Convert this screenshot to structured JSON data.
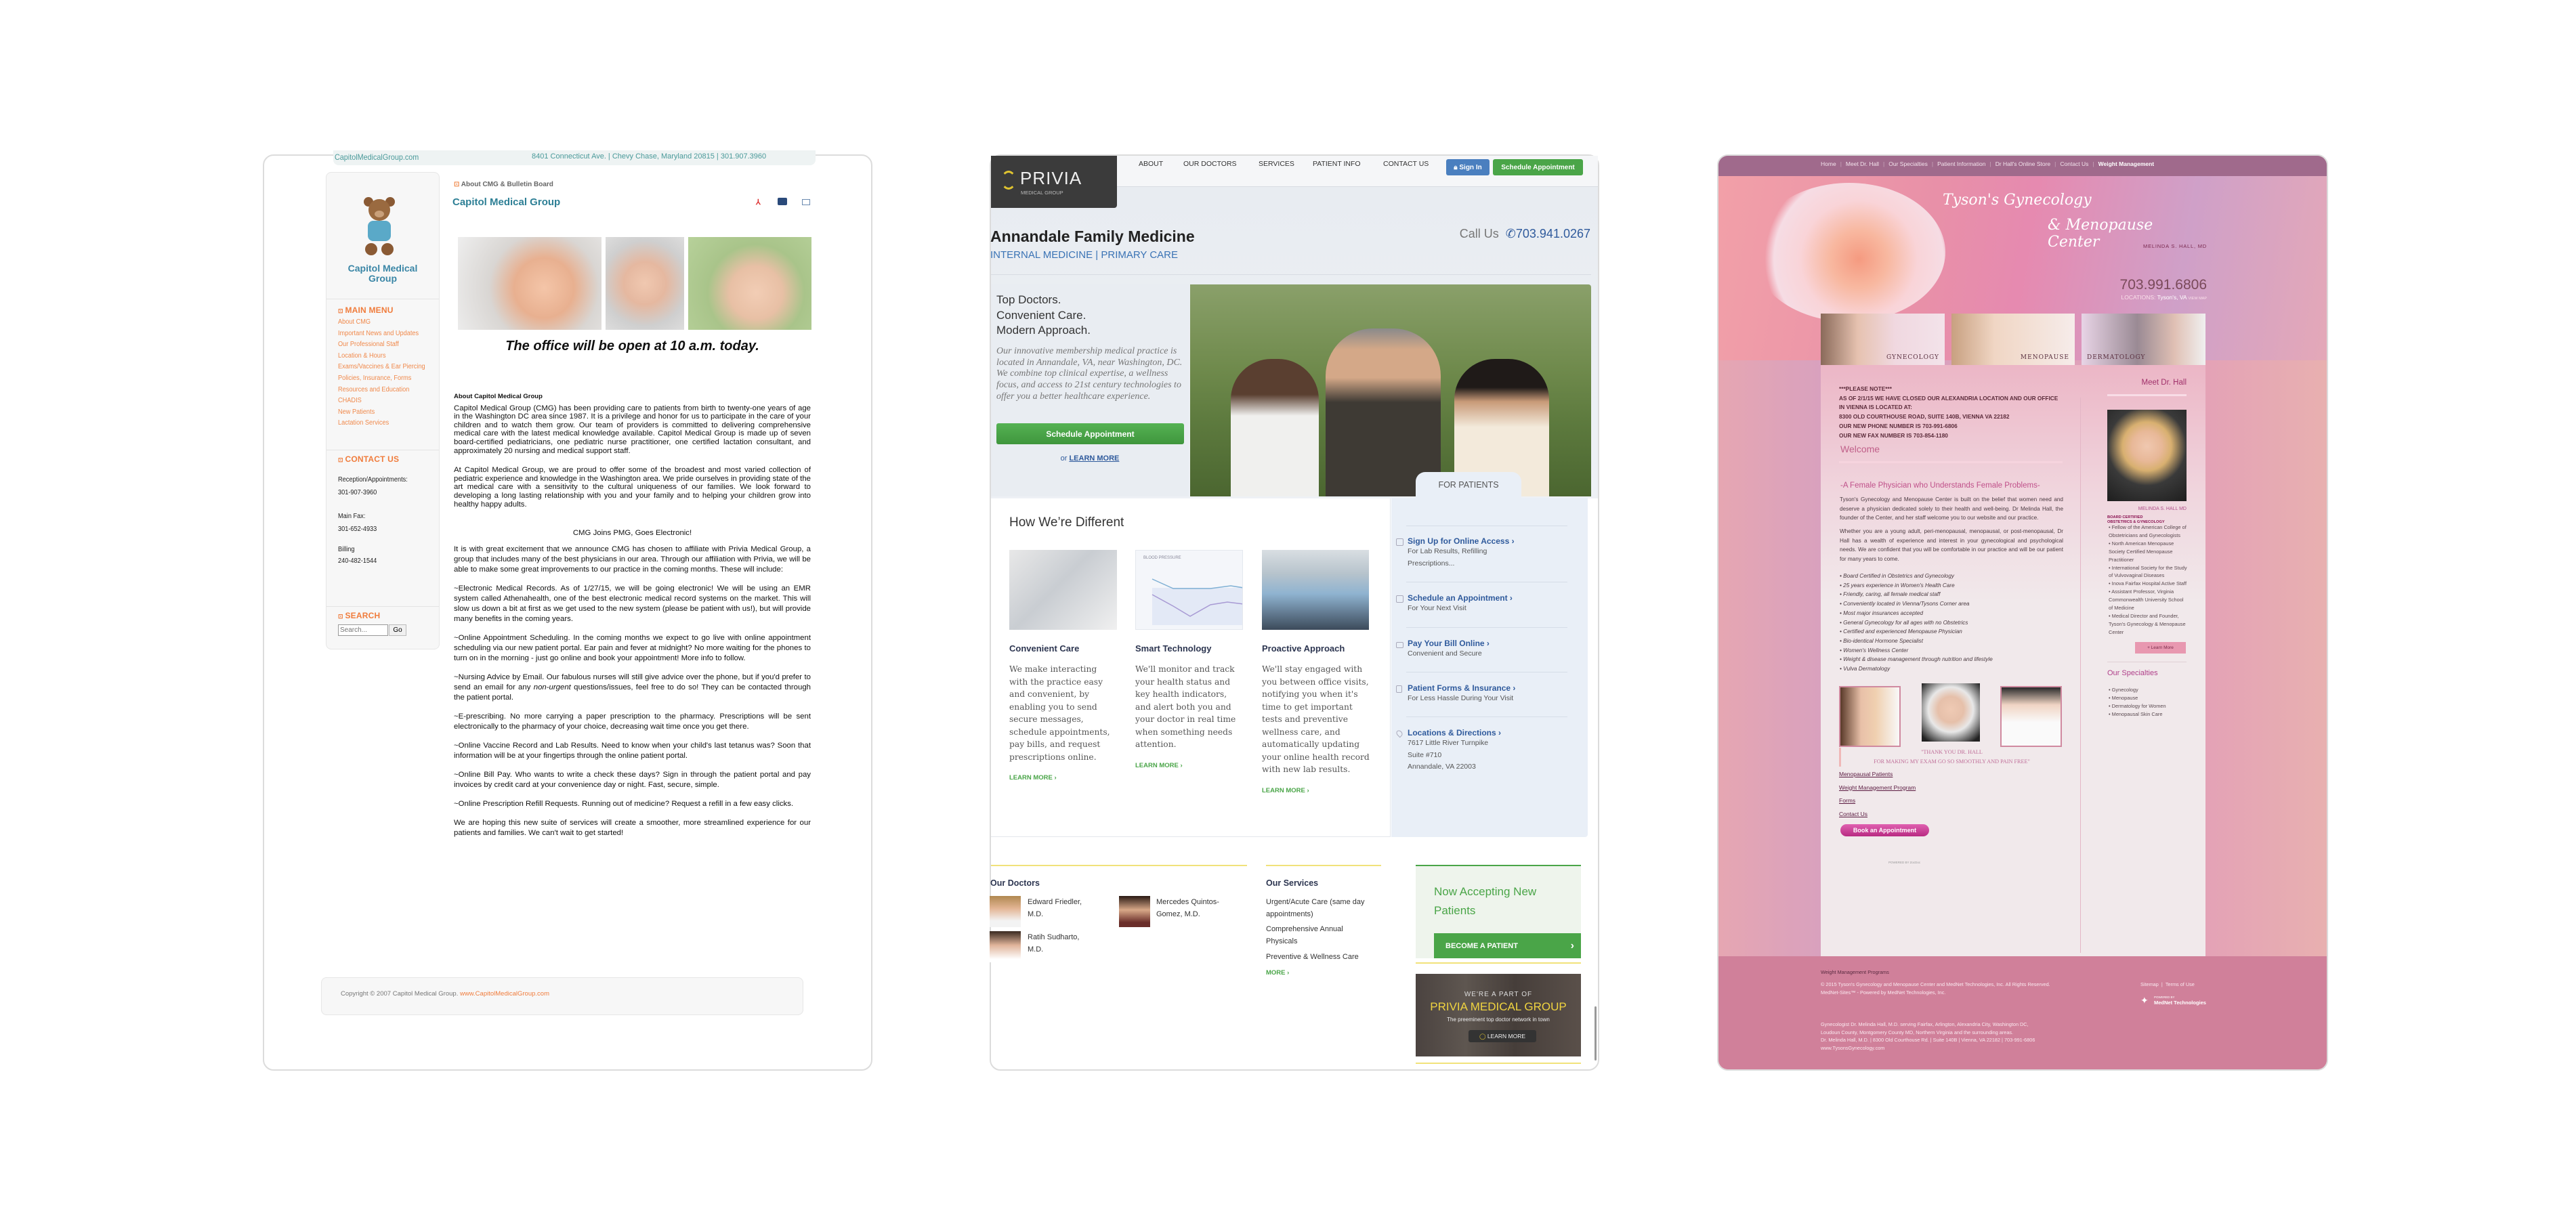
{
  "capitol": {
    "topbar": {
      "site": "CapitolMedicalGroup.com",
      "address": "8401 Connecticut Ave. | Chevy Chase, Maryland 20815  | 301.907.3960"
    },
    "logo_text": "Capitol Medical Group",
    "breadcrumb": "About CMG & Bulletin Board",
    "title": "Capitol Medical Group",
    "toolbar_icons": [
      "pdf-icon",
      "print-icon",
      "email-icon"
    ],
    "main_menu": {
      "heading": "MAIN MENU",
      "items": [
        "About CMG",
        "Important News and Updates",
        "Our Professional Staff",
        "Location & Hours",
        "Exams/Vaccines & Ear Piercing",
        "Policies, Insurance, Forms",
        "Resources and Education",
        "CHADIS",
        "New Patients",
        "Lactation Services"
      ]
    },
    "contact": {
      "heading": "CONTACT US",
      "reception_label": "Reception/Appointments:",
      "reception": "301-907-3960",
      "fax_label": "Main Fax:",
      "fax": "301-652-4933",
      "billing_label": "Billing",
      "billing": "240-482-1544"
    },
    "search": {
      "heading": "SEARCH",
      "placeholder": "Search...",
      "button": "Go"
    },
    "notice": "The office will be open at 10 a.m. today.",
    "about_heading": "About Capitol Medical Group",
    "p1": "Capitol Medical Group (CMG) has been providing care to patients from birth to twenty-one years of age in the Washington DC area since 1987.  It is a privilege and honor for us to participate in the care of your children and to watch them grow.  Our team of providers is committed to delivering comprehensive medical care with the latest medical knowledge available.  Capitol Medical Group is made up of seven board-certified pediatricians, one pediatric nurse practitioner, one certified lactation consultant, and approximately 20 nursing and medical support staff.",
    "p2": "At Capitol Medical Group, we are proud to offer some of the broadest and most varied collection of pediatric experience and knowledge in the Washington area.  We pride ourselves in providing state of the art medical care with a sensitivity to the cultural uniqueness of our families.  We look forward to developing a long lasting relationship with you and your family and to helping your children grow into healthy happy adults.",
    "news_heading": "CMG Joins PMG, Goes Electronic!",
    "p3": "It is with great excitement that we announce CMG has chosen to affiliate with Privia Medical Group, a group that includes many of the best physicians in our area.  Through our affiliation with Privia, we will be able to make some great improvements to our practice in the coming months.  These will include:",
    "p_emr": "~Electronic Medical Records.  As of 1/27/15, we will be going electronic!  We will be using an EMR system called Athenahealth, one of the best electronic medical record systems on the market.  This will slow us down a bit at first as we get used to the new system (please be patient with us!), but will provide many benefits in the coming years.",
    "p_sched": "~Online Appointment Scheduling. In the coming months we expect to go live with online appointment scheduling via our new patient portal. Ear pain and fever at midnight?  No more waiting for the phones to turn on in the morning - just go online and book your appointment!  More info to follow.",
    "p_nurse_a": "~Nursing Advice by Email.  Our fabulous nurses will still give advice over the phone, but if you'd prefer to send an email for any ",
    "p_nurse_i": "non-urgent",
    "p_nurse_b": " questions/issues, feel free to do so!  They can be contacted through the patient portal.",
    "p_erx": "~E-prescribing.  No more carrying a paper prescription to the pharmacy.  Prescriptions will be sent electronically to the pharmacy of your choice, decreasing wait time once you get there.",
    "p_vacc": "~Online Vaccine Record and Lab Results.  Need to know when your child's last tetanus was?  Soon that information will be at your fingertips through the online patient portal.",
    "p_bill": "~Online Bill Pay.  Who wants to write a check these days?  Sign in through the patient portal and pay invoices by credit card at your convenience day or night.  Fast, secure, simple.",
    "p_refill": "~Online Prescription Refill Requests.  Running out of medicine?  Request a refill in a few easy clicks.",
    "p_end": "We are hoping this new suite of services will create a smoother, more streamlined experience for our patients and families.  We can't wait to get started!",
    "footer": {
      "copyright": "Copyright © 2007 Capitol Medical Group. ",
      "link": "www.CapitolMedicalGroup.com"
    }
  },
  "privia": {
    "logo": {
      "name": "PRIVIA",
      "sub": "MEDICAL GROUP"
    },
    "nav": [
      "ABOUT",
      "OUR DOCTORS",
      "SERVICES",
      "PATIENT INFO",
      "CONTACT US"
    ],
    "sign_in": "Sign In",
    "schedule": "Schedule Appointment",
    "title": "Annandale Family Medicine",
    "subtitle": "INTERNAL MEDICINE | PRIMARY CARE",
    "call_label": "Call Us",
    "phone": "703.941.0267",
    "hero": {
      "lines": [
        "Top Doctors.",
        "Convenient Care.",
        "Modern Approach."
      ],
      "text": "Our innovative membership medical practice is located in Annandale, VA, near Washington, DC. We combine top clinical expertise, a wellness focus, and access to 21st century technologies to offer you a better healthcare experience.",
      "button": "Schedule Appointment",
      "or": "or ",
      "learn": "LEARN MORE"
    },
    "for_patients": "FOR PATIENTS",
    "different": {
      "heading": "How We’re Different",
      "chart_label": "BLOOD PRESSURE",
      "cols": [
        {
          "title": "Convenient Care",
          "text": "We make interacting with the practice easy and convenient, by enabling you to send secure messages, schedule appointments, pay bills, and request prescriptions online.",
          "link": "LEARN MORE ›"
        },
        {
          "title": "Smart Technology",
          "text": "We'll monitor and track your health status and key health indicators, and alert both you and your doctor in real time when something needs attention.",
          "link": "LEARN MORE ›"
        },
        {
          "title": "Proactive Approach",
          "text": "We'll stay engaged with you between office visits, notifying you when it's time to get important tests and preventive wellness care, and automatically updating your online health record with new lab results.",
          "link": "LEARN MORE ›"
        }
      ]
    },
    "patients": [
      {
        "icon": "edit-icon",
        "title": "Sign Up for Online Access ›",
        "sub": "For Lab Results, Refilling Prescriptions..."
      },
      {
        "icon": "calendar-icon",
        "title": "Schedule an Appointment ›",
        "sub": "For Your Next Visit"
      },
      {
        "icon": "credit-card-icon",
        "title": "Pay Your Bill Online ›",
        "sub": "Convenient and Secure"
      },
      {
        "icon": "document-icon",
        "title": "Patient Forms & Insurance ›",
        "sub": "For Less Hassle During Your Visit"
      },
      {
        "icon": "map-pin-icon",
        "title": "Locations & Directions ›",
        "sub": "7617 Little River Turnpike",
        "sub2": "Suite #710",
        "sub3": "Annandale, VA 22003"
      }
    ],
    "doctors": {
      "heading": "Our Doctors",
      "list": [
        "Edward Friedler, M.D.",
        "Mercedes Quintos-Gomez, M.D.",
        "Ratih Sudharto, M.D."
      ]
    },
    "services": {
      "heading": "Our Services",
      "list": [
        "Urgent/Acute Care (same day appointments)",
        "Comprehensive Annual Physicals",
        "Preventive & Wellness Care"
      ],
      "more": "MORE ›"
    },
    "accepting": {
      "title": "Now Accepting New Patients",
      "button": "BECOME A PATIENT",
      "arrow": "›"
    },
    "banner": {
      "pre": "WE'RE A PART OF",
      "name": "PRIVIA MEDICAL GROUP",
      "tag": "The preeminent top doctor network in town",
      "button": "LEARN MORE"
    },
    "colors": {
      "green": "#4aa548",
      "blue": "#4a7fbf",
      "navy": "#2f5a9c"
    }
  },
  "tysons": {
    "nav": [
      "Home",
      "Meet Dr. Hall",
      "Our Specialties",
      "Patient Information",
      "Dr Hall's Online Store",
      "Contact Us",
      "Weight Management"
    ],
    "logo": {
      "line1": "Tyson's Gynecology",
      "line2": "& Menopause Center",
      "doctor": "MELINDA S. HALL, MD"
    },
    "phone": "703.991.6806",
    "locations_label": "LOCATIONS:",
    "location": "Tyson's, VA",
    "view_map": "VIEW MAP",
    "tiles": [
      "GYNECOLOGY",
      "MENOPAUSE",
      "DERMATOLOGY"
    ],
    "note": [
      "***PLEASE NOTE***",
      "AS OF 2/1/15 WE HAVE CLOSED OUR ALEXANDRIA LOCATION AND OUR OFFICE",
      "IN VIENNA IS LOCATED AT:",
      "8300 OLD COURTHOUSE ROAD, SUITE 140B, VIENNA VA 22182",
      "OUR NEW PHONE NUMBER IS 703-991-6806",
      "OUR NEW FAX NUMBER IS 703-854-1180"
    ],
    "welcome": "Welcome",
    "tagline": "-A Female Physician who Understands Female Problems-",
    "para1": "Tyson's Gynecology and Menopause Center is built on the belief that women need and deserve a physician dedicated solely to their health and well-being. Dr Melinda Hall, the founder of the Center, and her staff welcome you to our website and our practice.",
    "para2": "Whether you are a young adult, peri-menopausal, menopausal, or post-menopausal, Dr Hall has a wealth of experience and interest in your gynecological and psychological needs. We are confident that you will be comfortable in our practice and will be our patient for many years to come.",
    "bullets": [
      "Board Certified in Obstetrics and Gynecology",
      "25 years experience in Women's Health Care",
      "Friendly, caring, all female medical staff",
      "Conveniently located in Vienna/Tysons Corner area",
      "Most major insurances accepted",
      "General Gynecology for all ages with no Obstetrics",
      "Certified and experienced Menopause Physician",
      "Bio-identical Hormone Specialist",
      "Women's Wellness Center",
      "Weight & disease management through nutrition and lifestyle",
      "Vulva Dermatology"
    ],
    "quote1": "\"THANK YOU DR. HALL",
    "quote2": "FOR MAKING MY EXAM GO SO SMOOTHLY AND PAIN FREE\"",
    "links": [
      "Menopausal Patients",
      "Weight Management  Program",
      "Forms",
      "Contact Us"
    ],
    "book": "Book an Appointment",
    "zocdoc": "POWERED BY ZocDoc",
    "meet": {
      "heading": "Meet Dr. Hall",
      "name": "MELINDA S. HALL MD",
      "cert1": "BOARD CERTIFIED",
      "cert2": "OBSTETRICS & GYNECOLOGY",
      "items": [
        "Fellow of the American College of Obstetricians and Gynecologists",
        "North American Menopause Society Certified Menopause Practitioner",
        "International Society for the Study of Vulvovaginal Diseases",
        "Inova Fairfax Hospital Active Staff",
        "Assistant Professor, Virginia Commonwealth University School of Medicine",
        "Medical Director and Founder, Tyson's Gynecology & Menopause Center"
      ],
      "learn": "+  Learn More"
    },
    "specialties": {
      "heading": "Our Specialties",
      "items": [
        "Gynecology",
        "Menopause",
        "Dermatology for Women",
        "Menopausal Skin Care"
      ]
    },
    "footer": {
      "wm": "Weight Management Programs",
      "copy1": "© 2015 Tyson's Gynecology and Menopause Center and MedNet Technologies, Inc. All Rights Reserved.",
      "copy2": "MedNet-Sites™ - Powered by MedNet Technologies, Inc.",
      "sitemap": "Sitemap",
      "sep": "|",
      "terms": "Terms of Use",
      "powered": "POWERED BY",
      "mednet": "MedNet Technologies",
      "seo1": "Gynecologist Dr. Melinda Hall, M.D. serving Fairfax, Arlington, Alexandria City, Washington DC,",
      "seo2": "Loudoun County, Montgomery County MD, Northern Virginia and the surrounding areas.",
      "seo3": "Dr. Melinda Hall, M.D. | 8300 Old Courthouse Rd. | Suite 140B | Vienna, VA 22182 | 703-991-6806",
      "seo4": "www.TysonsGynecology.com"
    },
    "colors": {
      "nav": "#a06a8c",
      "footer": "#d0809a",
      "accent": "#c0307f"
    }
  }
}
